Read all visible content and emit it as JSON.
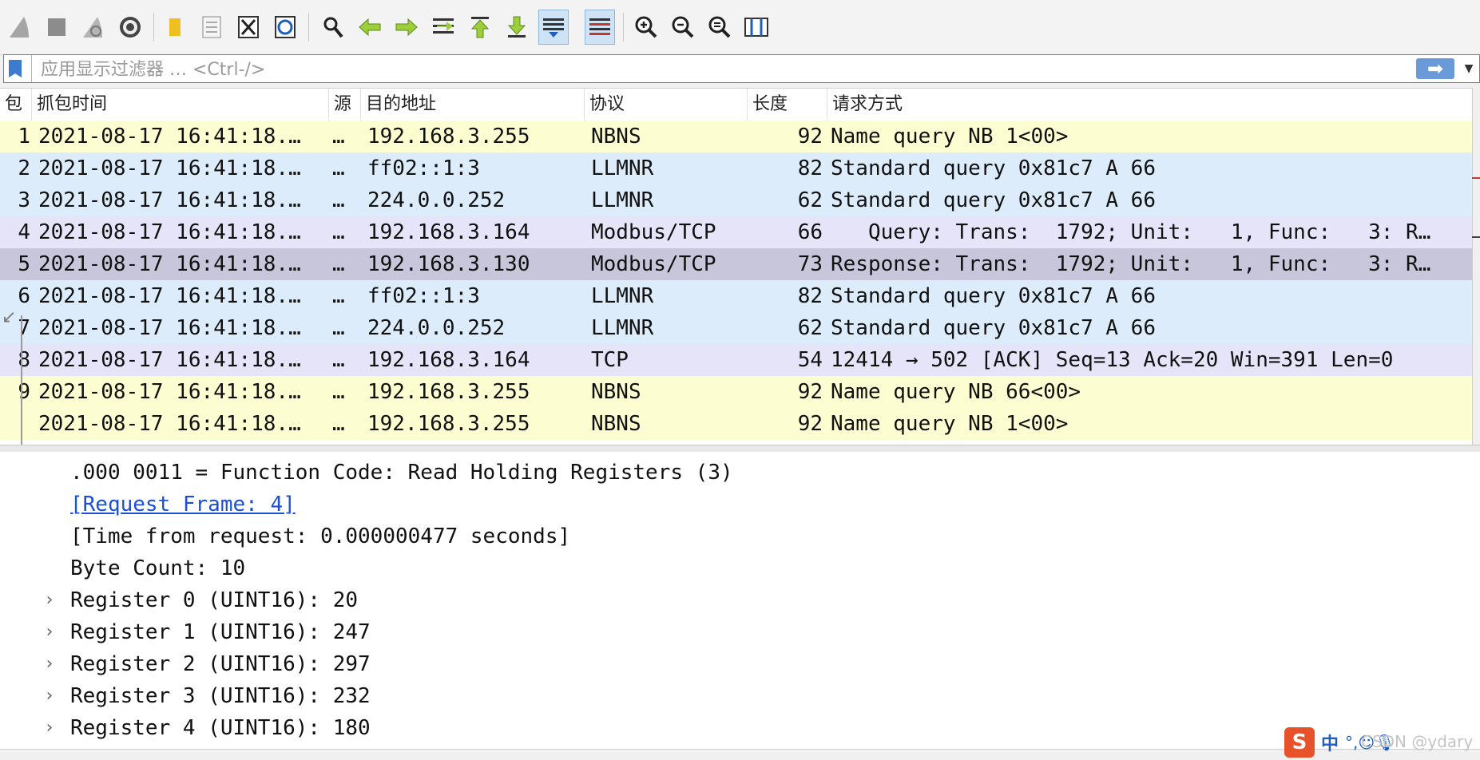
{
  "toolbar": {
    "icons": [
      "shark-fin-start-icon",
      "stop-icon",
      "restart-icon",
      "options-gear-icon",
      "open-folder-icon",
      "save-file-icon",
      "close-file-icon",
      "reload-icon",
      "find-icon",
      "back-arrow-icon",
      "forward-arrow-icon",
      "go-to-packet-icon",
      "first-packet-icon",
      "last-packet-icon",
      "auto-scroll-icon",
      "colorize-icon",
      "zoom-in-icon",
      "zoom-out-icon",
      "normal-size-icon",
      "resize-columns-icon"
    ]
  },
  "filter": {
    "placeholder": "应用显示过滤器 … <Ctrl-/>",
    "apply_glyph": "➡",
    "dropdown_glyph": "▼"
  },
  "columns": {
    "no": "包",
    "time": "抓包时间",
    "source": "源",
    "destination": "目的地址",
    "protocol": "协议",
    "length": "长度",
    "info": "请求方式"
  },
  "packets": [
    {
      "no": "1",
      "time": "2021-08-17 16:41:18.…",
      "src": "…",
      "dst": "192.168.3.255",
      "proto": "NBNS",
      "len": "92",
      "info": "Name query NB 1<00>",
      "color": "#fdfdd2"
    },
    {
      "no": "2",
      "time": "2021-08-17 16:41:18.…",
      "src": "…",
      "dst": "ff02::1:3",
      "proto": "LLMNR",
      "len": "82",
      "info": "Standard query 0x81c7 A 66",
      "color": "#dcecfa"
    },
    {
      "no": "3",
      "time": "2021-08-17 16:41:18.…",
      "src": "…",
      "dst": "224.0.0.252",
      "proto": "LLMNR",
      "len": "62",
      "info": "Standard query 0x81c7 A 66",
      "color": "#dcecfa"
    },
    {
      "no": "4",
      "time": "2021-08-17 16:41:18.…",
      "src": "…",
      "dst": "192.168.3.164",
      "proto": "Modbus/TCP",
      "len": "66",
      "info": "   Query: Trans:  1792; Unit:   1, Func:   3: R…",
      "color": "#e6e4f8"
    },
    {
      "no": "5",
      "time": "2021-08-17 16:41:18.…",
      "src": "…",
      "dst": "192.168.3.130",
      "proto": "Modbus/TCP",
      "len": "73",
      "info": "Response: Trans:  1792; Unit:   1, Func:   3: R…",
      "color": "#c8c6db"
    },
    {
      "no": "6",
      "time": "2021-08-17 16:41:18.…",
      "src": "…",
      "dst": "ff02::1:3",
      "proto": "LLMNR",
      "len": "82",
      "info": "Standard query 0x81c7 A 66",
      "color": "#dcecfa"
    },
    {
      "no": "7",
      "time": "2021-08-17 16:41:18.…",
      "src": "…",
      "dst": "224.0.0.252",
      "proto": "LLMNR",
      "len": "62",
      "info": "Standard query 0x81c7 A 66",
      "color": "#dcecfa"
    },
    {
      "no": "8",
      "time": "2021-08-17 16:41:18.…",
      "src": "…",
      "dst": "192.168.3.164",
      "proto": "TCP",
      "len": "54",
      "info": "12414 → 502 [ACK] Seq=13 Ack=20 Win=391 Len=0",
      "color": "#e6e4f8"
    },
    {
      "no": "9",
      "time": "2021-08-17 16:41:18.…",
      "src": "…",
      "dst": "192.168.3.255",
      "proto": "NBNS",
      "len": "92",
      "info": "Name query NB 66<00>",
      "color": "#fdfdd2"
    },
    {
      "no": "",
      "time": "2021-08-17 16:41:18.…",
      "src": "…",
      "dst": "192.168.3.255",
      "proto": "NBNS",
      "len": "92",
      "info": "Name query NB 1<00>",
      "color": "#fdfdd2"
    }
  ],
  "details": [
    {
      "text": ".000 0011 = Function Code: Read Holding Registers (3)",
      "expandable": false,
      "link": false
    },
    {
      "text": "[Request Frame: 4]",
      "expandable": false,
      "link": true
    },
    {
      "text": "[Time from request: 0.000000477 seconds]",
      "expandable": false,
      "link": false
    },
    {
      "text": "Byte Count: 10",
      "expandable": false,
      "link": false
    },
    {
      "text": "Register 0 (UINT16): 20",
      "expandable": true,
      "link": false
    },
    {
      "text": "Register 1 (UINT16): 247",
      "expandable": true,
      "link": false
    },
    {
      "text": "Register 2 (UINT16): 297",
      "expandable": true,
      "link": false
    },
    {
      "text": "Register 3 (UINT16): 232",
      "expandable": true,
      "link": false
    },
    {
      "text": "Register 4 (UINT16): 180",
      "expandable": true,
      "link": false
    }
  ],
  "ime": {
    "logo": "S",
    "lang": "中",
    "icons": "°,☺🎙",
    "watermark": "CSDN @ydary"
  },
  "colors": {
    "accent": "#3c7bd0",
    "selected_row": "#c8c6db",
    "link": "#1a4fd6"
  }
}
